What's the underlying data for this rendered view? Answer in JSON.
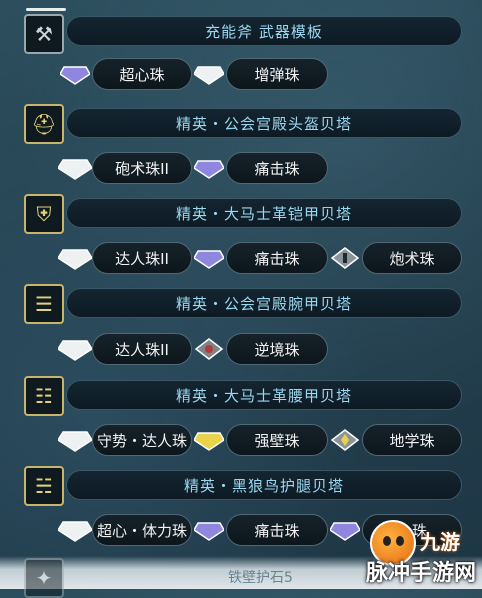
{
  "rows": [
    {
      "title": "充能斧 武器模板",
      "icon": "switch-axe-weapon-icon",
      "slots": [
        {
          "label": "超心珠",
          "gem": "purple"
        },
        {
          "label": "增弹珠",
          "gem": "white"
        }
      ]
    },
    {
      "title": "精英・公会宫殿头盔贝塔",
      "icon": "helmet-icon",
      "slots": [
        {
          "label": "砲术珠II",
          "gem": "white"
        },
        {
          "label": "痛击珠",
          "gem": "purple"
        }
      ]
    },
    {
      "title": "精英・大马士革铠甲贝塔",
      "icon": "chest-armor-icon",
      "slots": [
        {
          "label": "达人珠II",
          "gem": "white"
        },
        {
          "label": "痛击珠",
          "gem": "purple"
        },
        {
          "label": "炮术珠",
          "gem": "gray"
        }
      ]
    },
    {
      "title": "精英・公会宫殿腕甲贝塔",
      "icon": "arm-armor-icon",
      "slots": [
        {
          "label": "达人珠II",
          "gem": "white"
        },
        {
          "label": "逆境珠",
          "gem": "gray-red"
        }
      ]
    },
    {
      "title": "精英・大马士革腰甲贝塔",
      "icon": "waist-armor-icon",
      "slots": [
        {
          "label": "守势・达人珠",
          "gem": "white"
        },
        {
          "label": "强壁珠",
          "gem": "yellow"
        },
        {
          "label": "地学珠",
          "gem": "yellow-small"
        }
      ]
    },
    {
      "title": "精英・黑狼鸟护腿贝塔",
      "icon": "leg-armor-icon",
      "slots": [
        {
          "label": "超心・体力珠",
          "gem": "white"
        },
        {
          "label": "痛击珠",
          "gem": "purple"
        },
        {
          "label": "…珠",
          "gem": "purple"
        }
      ]
    }
  ],
  "charm": {
    "title": "铁壁护石5",
    "icon": "charm-icon"
  },
  "watermark": {
    "text": "脉冲手游网",
    "logo_text": "九游"
  },
  "colors": {
    "title_text": "#9ad8ef",
    "frame_gold": "#c8b56a",
    "gem_white": "#eef1f2",
    "gem_purple": "#8f86e0",
    "gem_yellow": "#e8d34a"
  }
}
